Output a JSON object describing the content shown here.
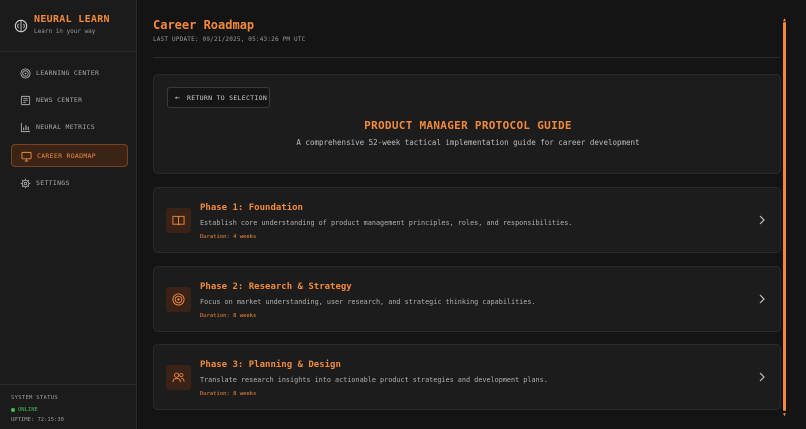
{
  "brand": {
    "title": "NEURAL LEARN",
    "subtitle": "Learn in your way"
  },
  "sidebar": {
    "items": [
      {
        "label": "LEARNING CENTER",
        "icon": "target-icon",
        "active": false
      },
      {
        "label": "NEWS CENTER",
        "icon": "newspaper-icon",
        "active": false
      },
      {
        "label": "NEURAL METRICS",
        "icon": "bar-chart-icon",
        "active": false
      },
      {
        "label": "CAREER ROADMAP",
        "icon": "monitor-icon",
        "active": true
      },
      {
        "label": "SETTINGS",
        "icon": "gear-icon",
        "active": false
      }
    ]
  },
  "system_status": {
    "title": "SYSTEM STATUS",
    "state": "ONLINE",
    "uptime": "UPTIME: 72:15:30"
  },
  "header": {
    "title": "Career Roadmap",
    "last_update": "LAST UPDATE: 09/21/2025, 05:43:26 PM UTC"
  },
  "guide": {
    "return_label": "RETURN TO SELECTION",
    "title": "PRODUCT MANAGER PROTOCOL GUIDE",
    "description": "A comprehensive 52-week tactical implementation guide for career development"
  },
  "phases": [
    {
      "title": "Phase 1: Foundation",
      "description": "Establish core understanding of product management principles, roles, and responsibilities.",
      "duration": "Duration: 4 weeks",
      "icon": "book-icon"
    },
    {
      "title": "Phase 2: Research & Strategy",
      "description": "Focus on market understanding, user research, and strategic thinking capabilities.",
      "duration": "Duration: 8 weeks",
      "icon": "target-icon"
    },
    {
      "title": "Phase 3: Planning & Design",
      "description": "Translate research insights into actionable product strategies and development plans.",
      "duration": "Duration: 8 weeks",
      "icon": "users-icon"
    }
  ],
  "colors": {
    "accent": "#f28a3c",
    "background": "#141414",
    "sidebar": "#1b1b1b",
    "card": "#1c1c1c",
    "online": "#3fb950"
  }
}
